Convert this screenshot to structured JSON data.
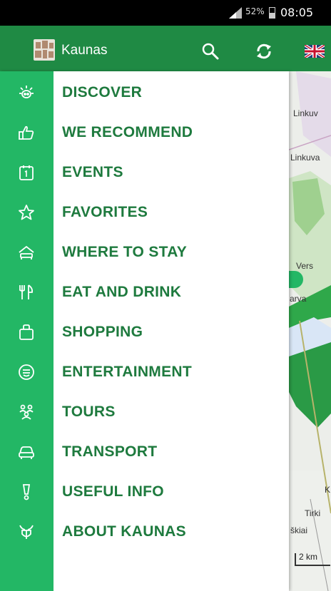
{
  "status_bar": {
    "battery": "52%",
    "time": "08:05"
  },
  "header": {
    "app_title": "Kaunas",
    "language": "English"
  },
  "menu": [
    {
      "label": "DISCOVER",
      "icon": "discover-icon"
    },
    {
      "label": "WE RECOMMEND",
      "icon": "thumbs-up-icon"
    },
    {
      "label": "EVENTS",
      "icon": "calendar-icon"
    },
    {
      "label": "FAVORITES",
      "icon": "star-icon"
    },
    {
      "label": "WHERE TO STAY",
      "icon": "bed-icon"
    },
    {
      "label": "EAT AND DRINK",
      "icon": "fork-knife-icon"
    },
    {
      "label": "SHOPPING",
      "icon": "shopping-bag-icon"
    },
    {
      "label": "ENTERTAINMENT",
      "icon": "smiley-icon"
    },
    {
      "label": "TOURS",
      "icon": "people-icon"
    },
    {
      "label": "TRANSPORT",
      "icon": "car-icon"
    },
    {
      "label": "USEFUL INFO",
      "icon": "info-icon"
    },
    {
      "label": "ABOUT KAUNAS",
      "icon": "coat-of-arms-icon"
    }
  ],
  "map": {
    "labels": [
      "Linkuv",
      "Linkuva",
      "Vers",
      "arva",
      "K",
      "Tirki",
      "škiai"
    ],
    "scale": "2 km"
  },
  "colors": {
    "header": "#1f8a44",
    "rail": "#23b765",
    "menu_text": "#1e7a3e"
  }
}
